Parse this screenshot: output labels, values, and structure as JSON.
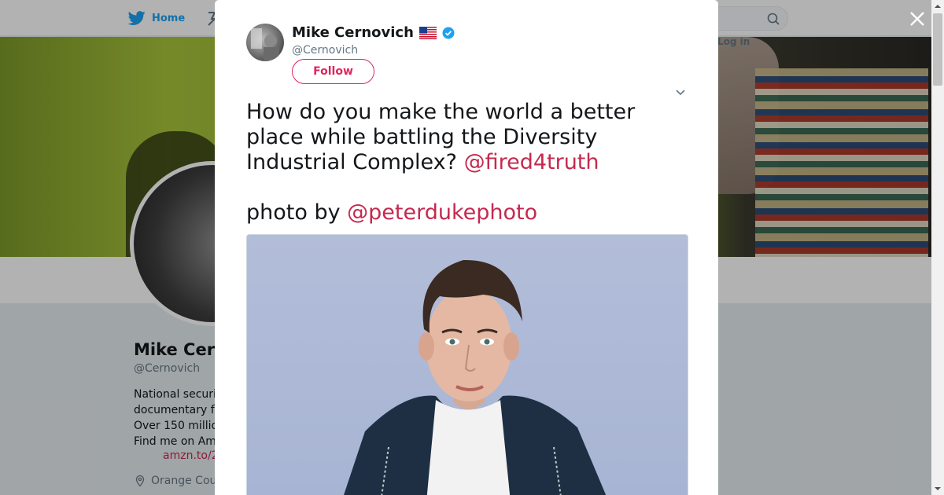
{
  "nav": {
    "home_label": "Home",
    "login_label": "Log in"
  },
  "profile": {
    "name": "Mike Cer",
    "handle": "@Cernovich",
    "bio_lines": [
      "National securi",
      "documentary f",
      "Over 150 millio",
      "Find me on Am"
    ],
    "link": "amzn.to/2",
    "location": "Orange Cou"
  },
  "tweet": {
    "author_name": "Mike Cernovich",
    "author_handle": "@Cernovich",
    "follow_label": "Follow",
    "text_main": "How do you make the world a better place while battling the Diversity Industrial Complex? ",
    "mention_1": "@fired4truth",
    "text_line2": "photo by ",
    "mention_2": "@peterdukephoto"
  },
  "icons": {
    "bird": "twitter-bird-icon",
    "search": "search-icon",
    "close": "close-icon",
    "verified": "verified-badge-icon",
    "flag": "us-flag-icon",
    "caret": "chevron-down-icon",
    "location": "location-pin-icon"
  },
  "colors": {
    "brand": "#1da1f2",
    "accent": "#e0245e",
    "mention": "#c5294f"
  }
}
